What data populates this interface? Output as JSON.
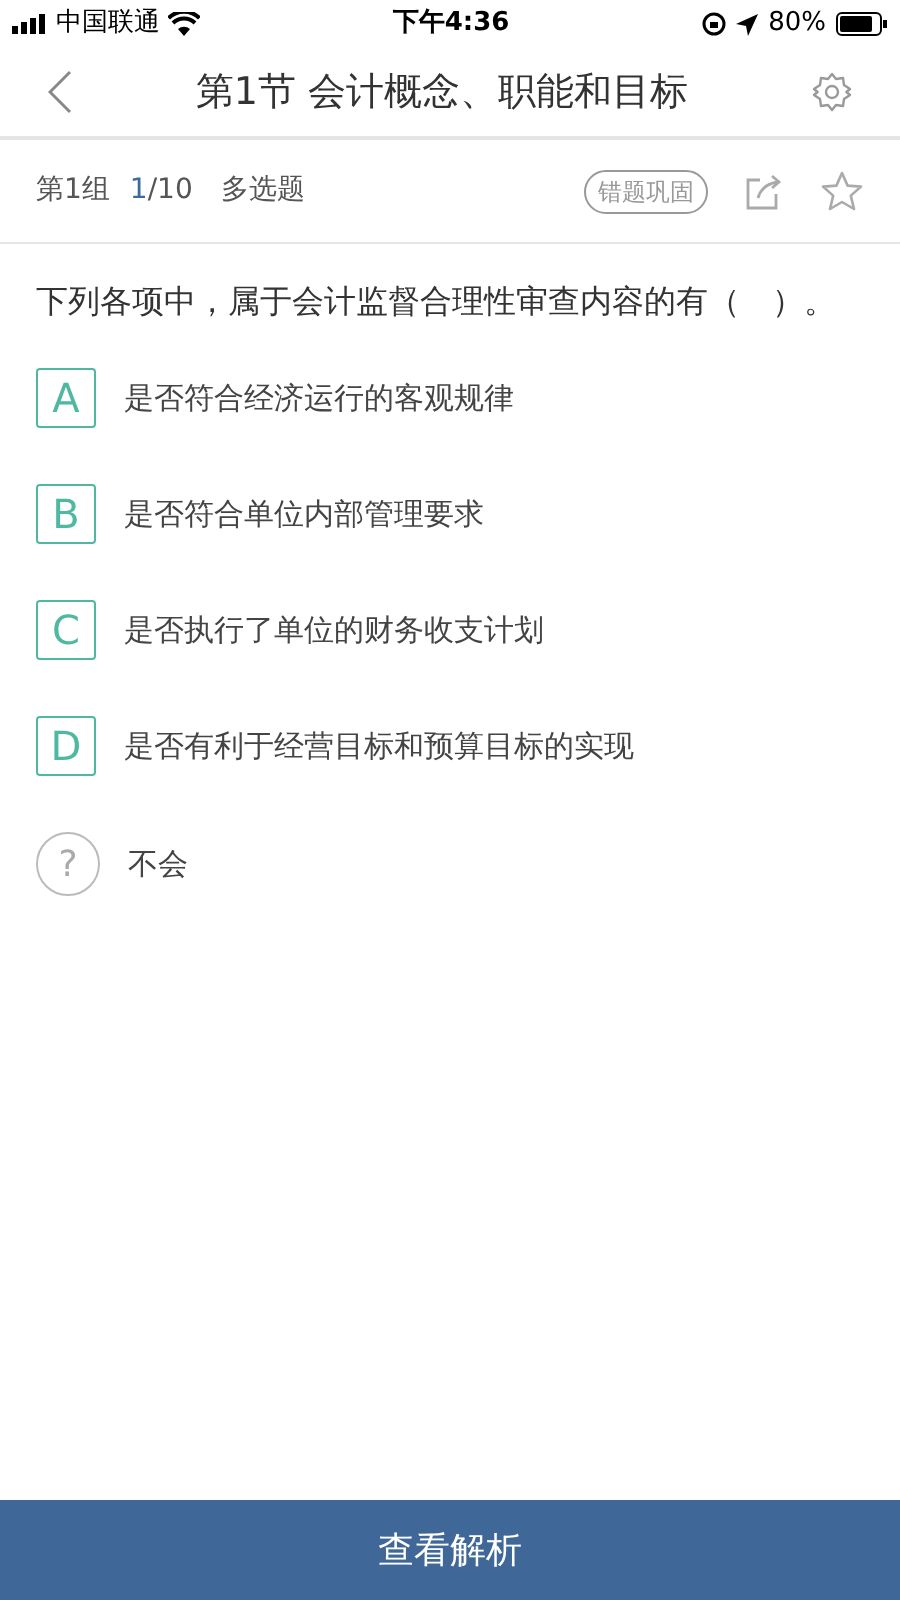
{
  "status_bar": {
    "carrier": "中国联通",
    "time": "下午4:36",
    "battery": "80%"
  },
  "nav": {
    "title": "第1节 会计概念、职能和目标"
  },
  "info_bar": {
    "group": "第1组",
    "progress_current": "1",
    "progress_total": "/10",
    "type": "多选题",
    "badge": "错题巩固"
  },
  "question": {
    "text": "下列各项中，属于会计监督合理性审查内容的有（　）。"
  },
  "options": [
    {
      "kind": "letter",
      "mark": "A",
      "text": "是否符合经济运行的客观规律"
    },
    {
      "kind": "letter",
      "mark": "B",
      "text": "是否符合单位内部管理要求"
    },
    {
      "kind": "letter",
      "mark": "C",
      "text": "是否执行了单位的财务收支计划"
    },
    {
      "kind": "letter",
      "mark": "D",
      "text": "是否有利于经营目标和预算目标的实现"
    },
    {
      "kind": "unknown",
      "mark": "?",
      "text": "不会"
    }
  ],
  "bottom_button": "查看解析"
}
